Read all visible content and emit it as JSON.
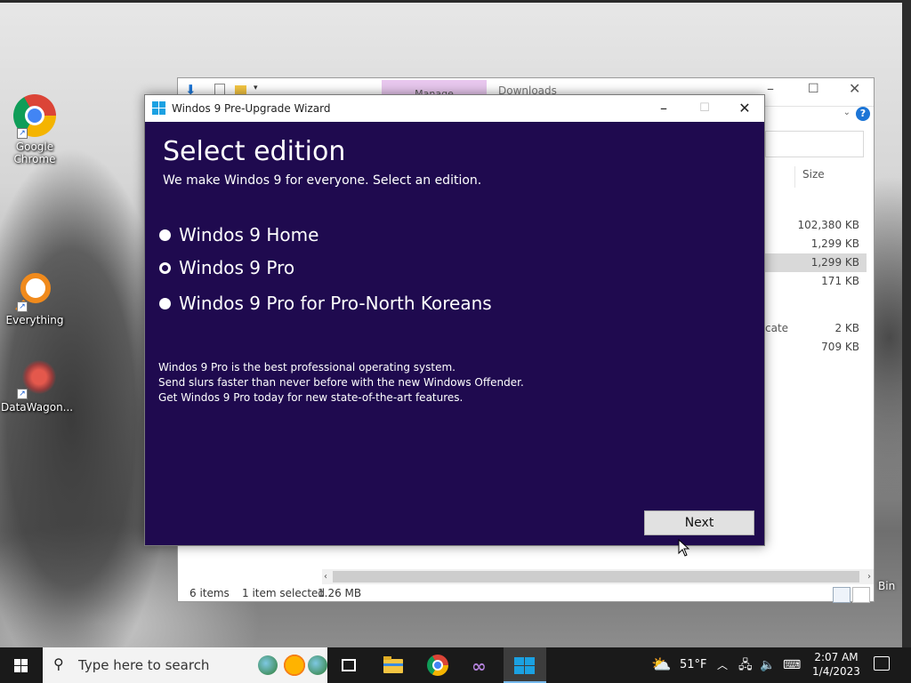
{
  "desktop": {
    "icons": [
      {
        "label": "Google Chrome"
      },
      {
        "label": "Everything"
      },
      {
        "label": "DataWagon..."
      }
    ],
    "recycle_bin_fragment": "Bin"
  },
  "explorer": {
    "manage_tab": "Manage",
    "path_tab": "Downloads",
    "size_header": "Size",
    "sizes": [
      "102,380 KB",
      "1,299 KB",
      "1,299 KB",
      "171 KB",
      "2 KB",
      "709 KB"
    ],
    "name_fragment": "cate",
    "status": {
      "items": "6 items",
      "selected": "1 item selected",
      "size": "1.26 MB"
    },
    "help_glyph": "?"
  },
  "wizard": {
    "title": "Windos 9 Pre-Upgrade Wizard",
    "heading": "Select edition",
    "subheading": "We make Windos 9 for everyone. Select an edition.",
    "options": [
      {
        "label": "Windos 9 Home",
        "selected": false
      },
      {
        "label": "Windos 9 Pro",
        "selected": true
      },
      {
        "label": "Windos 9 Pro for Pro-North Koreans",
        "selected": false
      }
    ],
    "description": [
      "Windos 9 Pro is the best professional operating system.",
      "Send slurs faster than never before with the new Windows Offender.",
      "Get Windos 9 Pro today for new state-of-the-art features."
    ],
    "next_label": "Next",
    "accent": "#1f0a4f"
  },
  "taskbar": {
    "search_placeholder": "Type here to search",
    "weather": "51°F",
    "time": "2:07 AM",
    "date": "1/4/2023"
  }
}
